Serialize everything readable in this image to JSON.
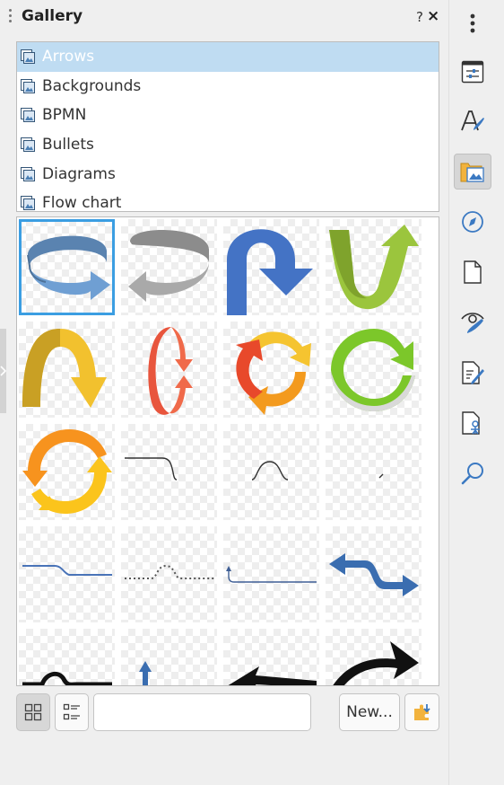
{
  "deck": {
    "title": "Gallery",
    "help_label": "?",
    "close_label": "×"
  },
  "themes": [
    {
      "label": "Arrows",
      "selected": true
    },
    {
      "label": "Backgrounds"
    },
    {
      "label": "BPMN"
    },
    {
      "label": "Bullets"
    },
    {
      "label": "Diagrams"
    },
    {
      "label": "Flow chart"
    }
  ],
  "gallery_items": [
    "arrow-ring-blue",
    "arrow-ring-gray",
    "arrow-uturn-blue",
    "arrow-u-green",
    "arrow-arch-yellow",
    "arrow-circle-red",
    "arrow-cycle-orange-yellow",
    "arrow-circle-green",
    "arrow-cycle-orange",
    "connector-line-bend",
    "connector-line-bump",
    "connector-line-small",
    "connector-line-step-blue",
    "connector-dotted-bump",
    "connector-line-arrow-blue",
    "arrow-double-s-blue",
    "arrow-curve-black",
    "arrow-up-blue",
    "arrow-left-black",
    "arrow-swoosh-black"
  ],
  "bottom": {
    "search_value": "",
    "new_label": "New..."
  },
  "tabbar": {
    "items": [
      "properties-icon",
      "styles-icon",
      "gallery-icon",
      "navigator-icon",
      "page-icon",
      "style-inspector-icon",
      "manage-changes-icon",
      "design-icon",
      "find-icon"
    ],
    "active": "gallery-icon"
  },
  "colors": {
    "selection": "#bfdcf2",
    "accent": "#3b9ee2"
  }
}
